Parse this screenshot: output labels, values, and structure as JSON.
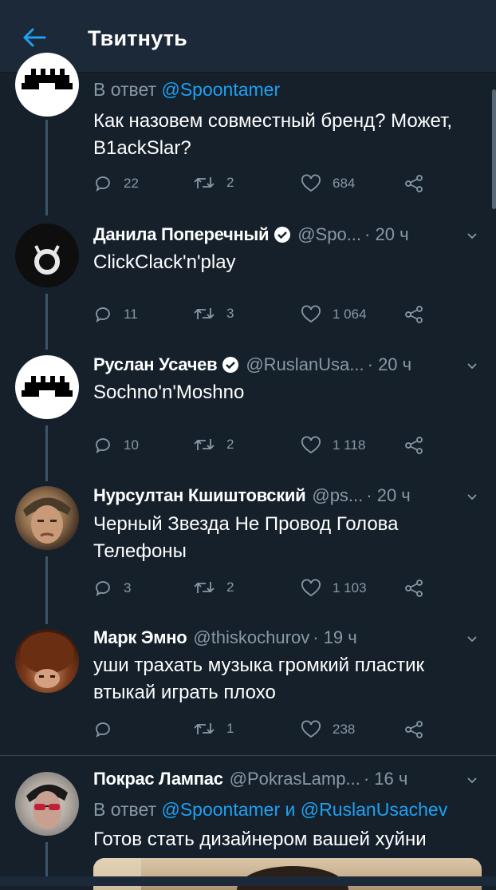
{
  "header": {
    "title": "Твитнуть"
  },
  "colors": {
    "background": "#15202b",
    "accent": "#1da1f2",
    "muted": "#8899a6",
    "verified": "#ffffff"
  },
  "tweets": [
    {
      "reply_prefix": "В ответ",
      "reply_to": "@Spoontamer",
      "text": "Как назовем совместный бренд? Может, B1ackSlar?",
      "replies": "22",
      "retweets": "2",
      "likes": "684",
      "avatar": "mustache-pixel-avatar"
    },
    {
      "name": "Данила Поперечный",
      "verified": true,
      "handle": "@Spo...",
      "time": "· 20 ч",
      "text": "ClickClack'n'play",
      "replies": "11",
      "retweets": "3",
      "likes": "1 064",
      "avatar": "dark-horned-avatar"
    },
    {
      "name": "Руслан Усачев",
      "verified": true,
      "handle": "@RuslanUsa...",
      "time": "· 20 ч",
      "text": "Sochno'n'Moshno",
      "replies": "10",
      "retweets": "2",
      "likes": "1 118",
      "avatar": "mustache-pixel-avatar"
    },
    {
      "name": "Нурсултан Кшиштовский",
      "verified": false,
      "handle": "@ps...",
      "time": "· 20 ч",
      "text": "Черный Звезда Не Провод Голова Телефоны",
      "replies": "3",
      "retweets": "2",
      "likes": "1 103",
      "avatar": "photo-face-avatar"
    },
    {
      "name": "Марк Эмно",
      "verified": false,
      "handle": "@thiskochurov",
      "time": "· 19 ч",
      "text": "уши трахать музыка громкий пластик втыкай играть плохо",
      "replies": "",
      "retweets": "1",
      "likes": "238",
      "avatar": "photo-hair-avatar"
    },
    {
      "name": "Покрас Лампас",
      "verified": false,
      "handle": "@PokrasLamp...",
      "time": "· 16 ч",
      "reply_prefix": "В ответ",
      "reply_to": "@Spoontamer",
      "reply_and": "и",
      "reply_to_2": "@RuslanUsachev",
      "text": "Готов стать дизайнером вашей хуйни",
      "avatar": "photo-sunglasses-avatar"
    }
  ]
}
